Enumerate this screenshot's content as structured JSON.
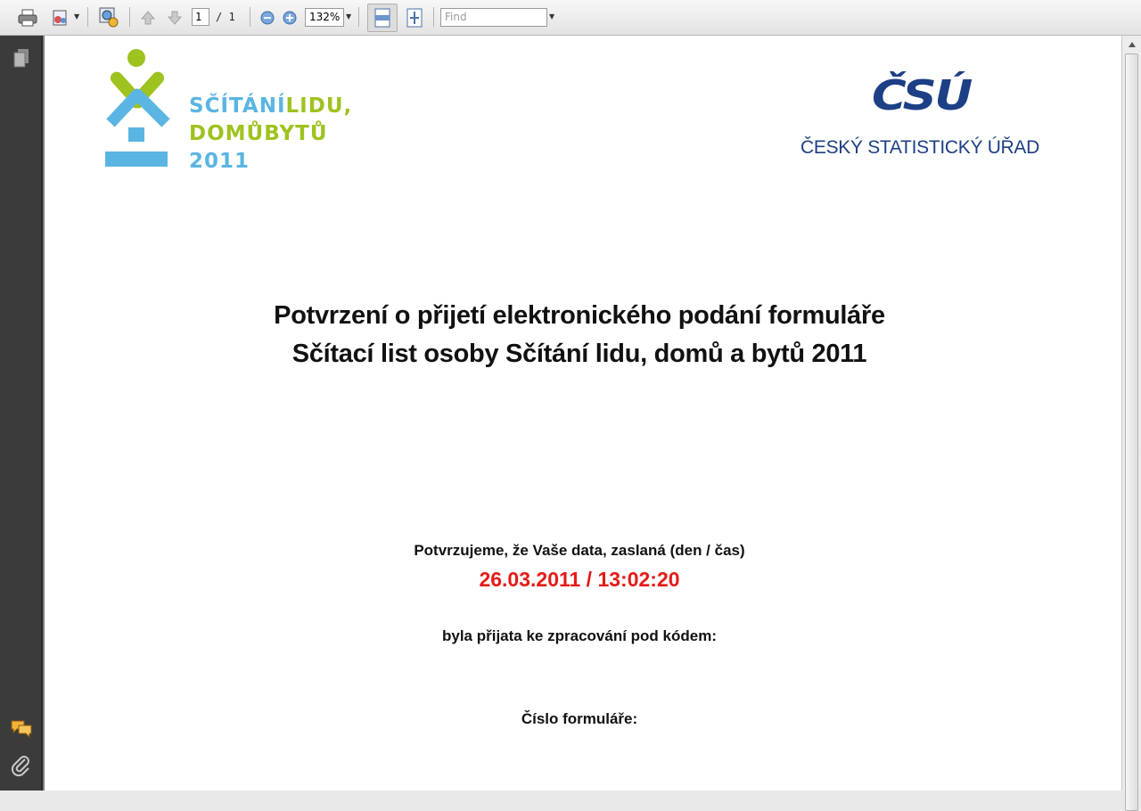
{
  "toolbar": {
    "page_current": "1",
    "page_total": "/ 1",
    "zoom": "132%",
    "find_placeholder": "Find",
    "icons": [
      "printer-icon",
      "save-icon",
      "export-icon",
      "previous-page-icon",
      "next-page-icon",
      "zoom-out-icon",
      "zoom-in-icon",
      "fit-width-icon",
      "fit-page-icon"
    ]
  },
  "sidebar": {
    "icons": [
      "pages-icon",
      "comments-icon",
      "attachments-icon"
    ]
  },
  "document": {
    "logo": {
      "line1_a": "SČÍTÁNÍ",
      "line1_b": "LIDU,",
      "line2_a": "DOMŮ",
      "line2_b": "BYTŮ",
      "line3": "2011"
    },
    "csu_mark": "ČSÚ",
    "csu_name": "ČESKÝ STATISTICKÝ ÚŘAD",
    "title_line1": "Potvrzení o přijetí elektronického podání formuláře",
    "title_line2": "Sčítací list osoby Sčítání lidu, domů a bytů 2011",
    "confirm_text": "Potvrzujeme, že Vaše data, zaslaná (den / čas)",
    "timestamp": "26.03.2011 / 13:02:20",
    "accepted_text": "byla přijata ke zpracování pod kódem:",
    "form_number_label": "Číslo formuláře:"
  },
  "colors": {
    "logo_blue": "#5bb5e2",
    "logo_green": "#9ec21f",
    "csu_blue": "#1d3f86",
    "timestamp_red": "#e41b17"
  }
}
